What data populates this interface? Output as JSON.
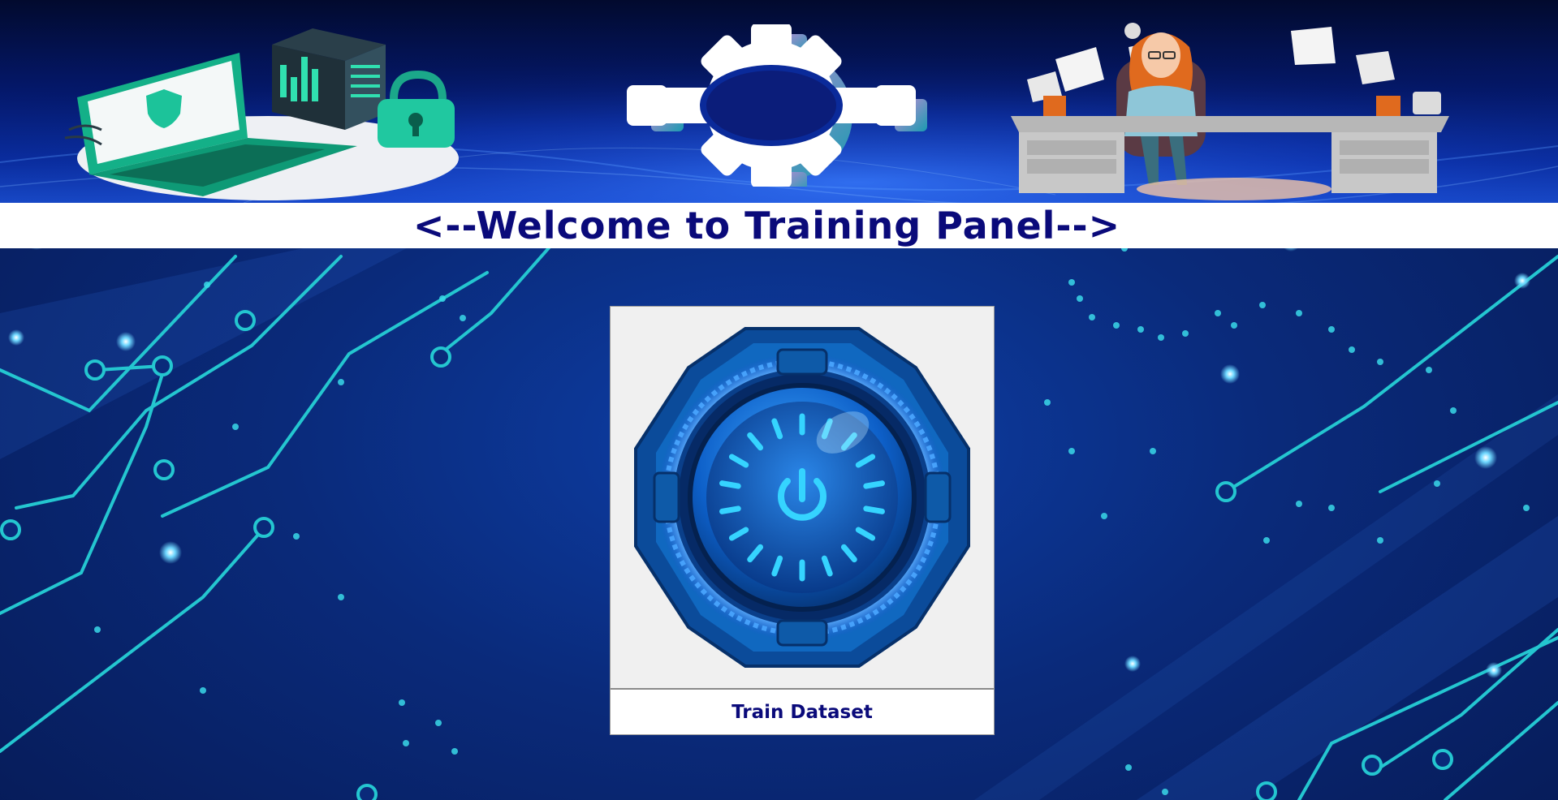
{
  "header": {
    "title": "<--Welcome to Training Panel-->"
  },
  "train_button": {
    "label": "Train Dataset"
  },
  "icons": {
    "left_art": "laptop-security-server-icon",
    "center_art": "gear-icon",
    "right_art": "office-worker-desk-icon",
    "button_art": "power-button-icon"
  },
  "colors": {
    "title_text": "#0a0a7a",
    "background": "#0a2a7a",
    "circuit": "#2ad4d4"
  }
}
